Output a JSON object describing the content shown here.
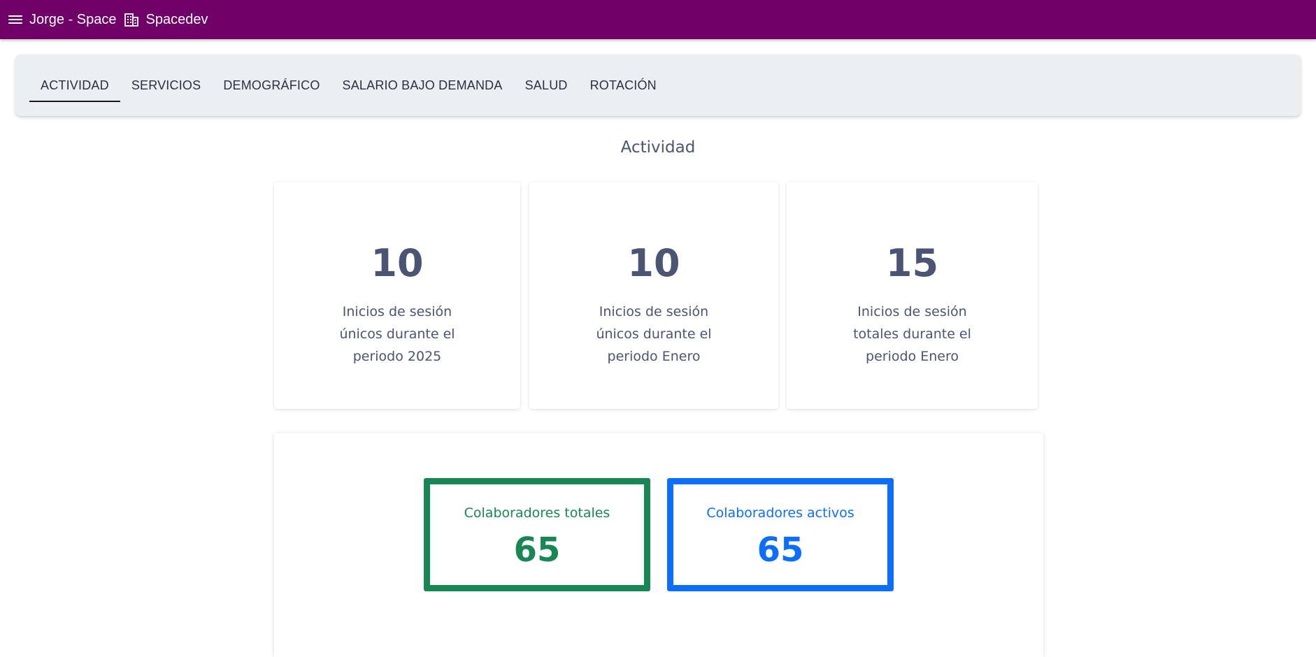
{
  "header": {
    "user": "Jorge - Space",
    "company": "Spacedev",
    "menu_icon": "menu-icon",
    "company_icon": "building-icon",
    "background_color": "#6e0068"
  },
  "tabs": [
    {
      "label": "ACTIVIDAD",
      "active": true
    },
    {
      "label": "SERVICIOS",
      "active": false
    },
    {
      "label": "DEMOGRÁFICO",
      "active": false
    },
    {
      "label": "SALARIO BAJO DEMANDA",
      "active": false
    },
    {
      "label": "SALUD",
      "active": false
    },
    {
      "label": "ROTACIÓN",
      "active": false
    }
  ],
  "main": {
    "title": "Actividad",
    "stats": [
      {
        "value": "10",
        "label": "Inicios de sesión únicos durante el periodo 2025"
      },
      {
        "value": "10",
        "label": "Inicios de sesión únicos durante el periodo Enero"
      },
      {
        "value": "15",
        "label": "Inicios de sesión totales durante el periodo Enero"
      }
    ],
    "collaborators": {
      "total": {
        "label": "Colaboradores totales",
        "value": "65",
        "color": "#198754"
      },
      "active": {
        "label": "Colaboradores activos",
        "value": "65",
        "color": "#0d6efd"
      }
    }
  }
}
